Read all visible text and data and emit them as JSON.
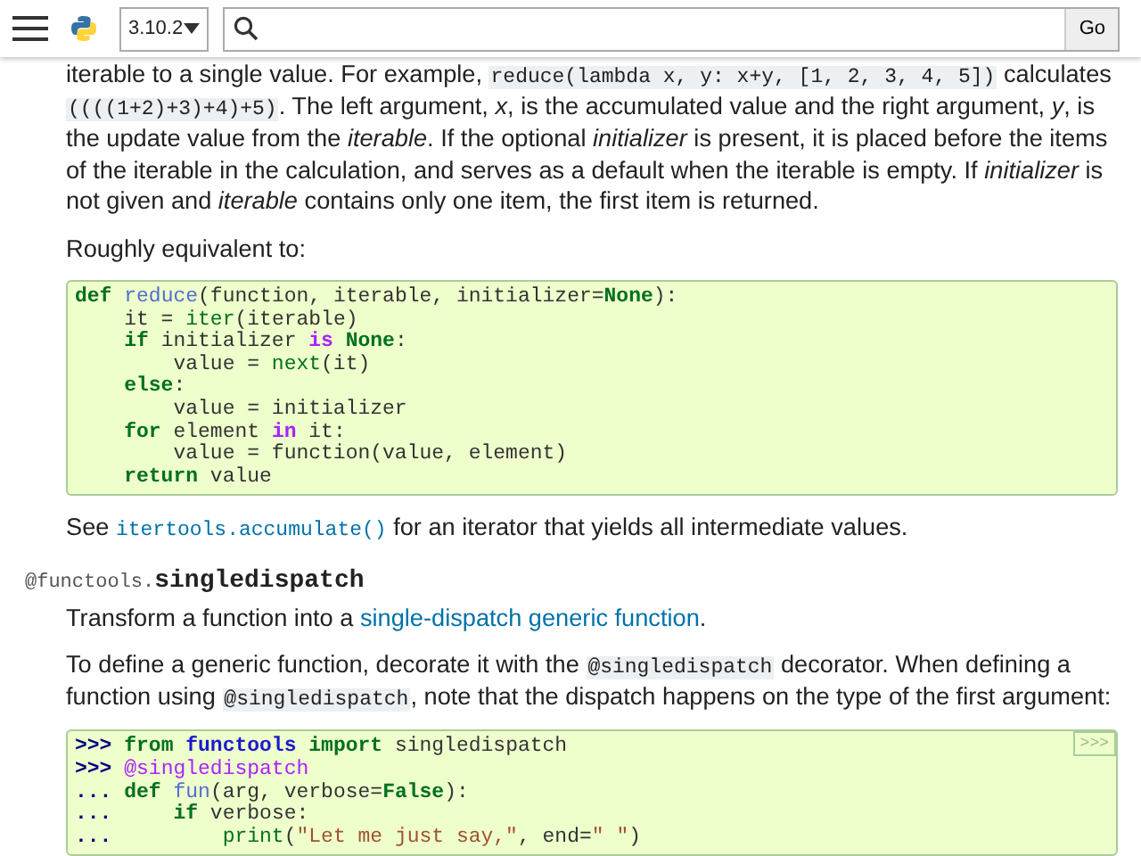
{
  "header": {
    "version": "3.10.2",
    "go_button": "Go"
  },
  "blocks": [
    {
      "kind": "para",
      "segments": [
        {
          "kind": "text",
          "text": "iterable to a single value. For example, "
        },
        {
          "kind": "code",
          "text": "reduce(lambda x, y: x+y, [1, 2, 3, 4, 5])"
        },
        {
          "kind": "text",
          "text": " calculates "
        },
        {
          "kind": "code",
          "text": "((((1+2)+3)+4)+5)"
        },
        {
          "kind": "text",
          "text": ". The left argument, *x*, is the accumulated value and the right argument, *y*, is the update value from the *iterable*. If the optional *initializer* is present, it is placed before the items of the iterable in the calculation, and serves as a default when the iterable is empty. If *initializer* is not given and *iterable* contains only one item, the first item is returned."
        }
      ]
    },
    {
      "kind": "para",
      "segments": [
        {
          "kind": "text",
          "text": "Roughly equivalent to:"
        }
      ]
    },
    {
      "kind": "code_block",
      "lines": [
        [
          {
            "kind": "k",
            "text": "def "
          },
          {
            "kind": "nf",
            "text": "reduce"
          },
          {
            "kind": "p",
            "text": "(function, iterable, initializer="
          },
          {
            "kind": "k",
            "text": "None"
          },
          {
            "kind": "p",
            "text": "):"
          }
        ],
        [
          {
            "kind": "p",
            "text": "    it = "
          },
          {
            "kind": "nb",
            "text": "iter"
          },
          {
            "kind": "p",
            "text": "(iterable)"
          }
        ],
        [
          {
            "kind": "k",
            "text": "    if"
          },
          {
            "kind": "p",
            "text": " initializer "
          },
          {
            "kind": "ow",
            "text": "is"
          },
          {
            "kind": "k",
            "text": " None"
          },
          {
            "kind": "p",
            "text": ":"
          }
        ],
        [
          {
            "kind": "p",
            "text": "        value = "
          },
          {
            "kind": "nb",
            "text": "next"
          },
          {
            "kind": "p",
            "text": "(it)"
          }
        ],
        [
          {
            "kind": "k",
            "text": "    else"
          },
          {
            "kind": "p",
            "text": ":"
          }
        ],
        [
          {
            "kind": "p",
            "text": "        value = initializer"
          }
        ],
        [
          {
            "kind": "k",
            "text": "    for"
          },
          {
            "kind": "p",
            "text": " element "
          },
          {
            "kind": "ow",
            "text": "in"
          },
          {
            "kind": "p",
            "text": " it:"
          }
        ],
        [
          {
            "kind": "p",
            "text": "        value = function(value, element)"
          }
        ],
        [
          {
            "kind": "k",
            "text": "    return"
          },
          {
            "kind": "p",
            "text": " value"
          }
        ]
      ]
    },
    {
      "kind": "para",
      "segments": [
        {
          "kind": "text",
          "text": "See "
        },
        {
          "kind": "linkcode",
          "text": "itertools.accumulate()"
        },
        {
          "kind": "text",
          "text": " for an iterator that yields all intermediate values."
        }
      ]
    },
    {
      "kind": "signature",
      "prefix": "@functools.",
      "name": "singledispatch"
    },
    {
      "kind": "para",
      "segments": [
        {
          "kind": "text",
          "text": "Transform a function into a "
        },
        {
          "kind": "link",
          "text": "single-dispatch generic function"
        },
        {
          "kind": "text",
          "text": "."
        }
      ]
    },
    {
      "kind": "para",
      "segments": [
        {
          "kind": "text",
          "text": "To define a generic function, decorate it with the "
        },
        {
          "kind": "code",
          "text": "@singledispatch"
        },
        {
          "kind": "text",
          "text": " decorator. When defining a function using "
        },
        {
          "kind": "code",
          "text": "@singledispatch"
        },
        {
          "kind": "text",
          "text": ", note that the dispatch happens on the type of the first argument:"
        }
      ]
    },
    {
      "kind": "code_block",
      "copy_label": ">>>",
      "lines": [
        [
          {
            "kind": "gp",
            "text": ">>> "
          },
          {
            "kind": "k",
            "text": "from "
          },
          {
            "kind": "nn",
            "text": "functools "
          },
          {
            "kind": "k",
            "text": "import "
          },
          {
            "kind": "p",
            "text": "singledispatch"
          }
        ],
        [
          {
            "kind": "gp",
            "text": ">>> "
          },
          {
            "kind": "nd",
            "text": "@singledispatch"
          }
        ],
        [
          {
            "kind": "gp",
            "text": "... "
          },
          {
            "kind": "k",
            "text": "def "
          },
          {
            "kind": "nf",
            "text": "fun"
          },
          {
            "kind": "p",
            "text": "(arg, verbose="
          },
          {
            "kind": "k",
            "text": "False"
          },
          {
            "kind": "p",
            "text": "):"
          }
        ],
        [
          {
            "kind": "gp",
            "text": "... "
          },
          {
            "kind": "k",
            "text": "    if"
          },
          {
            "kind": "p",
            "text": " verbose:"
          }
        ],
        [
          {
            "kind": "gp",
            "text": "... "
          },
          {
            "kind": "nb",
            "text": "        print"
          },
          {
            "kind": "p",
            "text": "("
          },
          {
            "kind": "s",
            "text": "\"Let me just say,\""
          },
          {
            "kind": "p",
            "text": ", end="
          },
          {
            "kind": "s",
            "text": "\" \""
          },
          {
            "kind": "p",
            "text": ")"
          }
        ]
      ]
    }
  ]
}
